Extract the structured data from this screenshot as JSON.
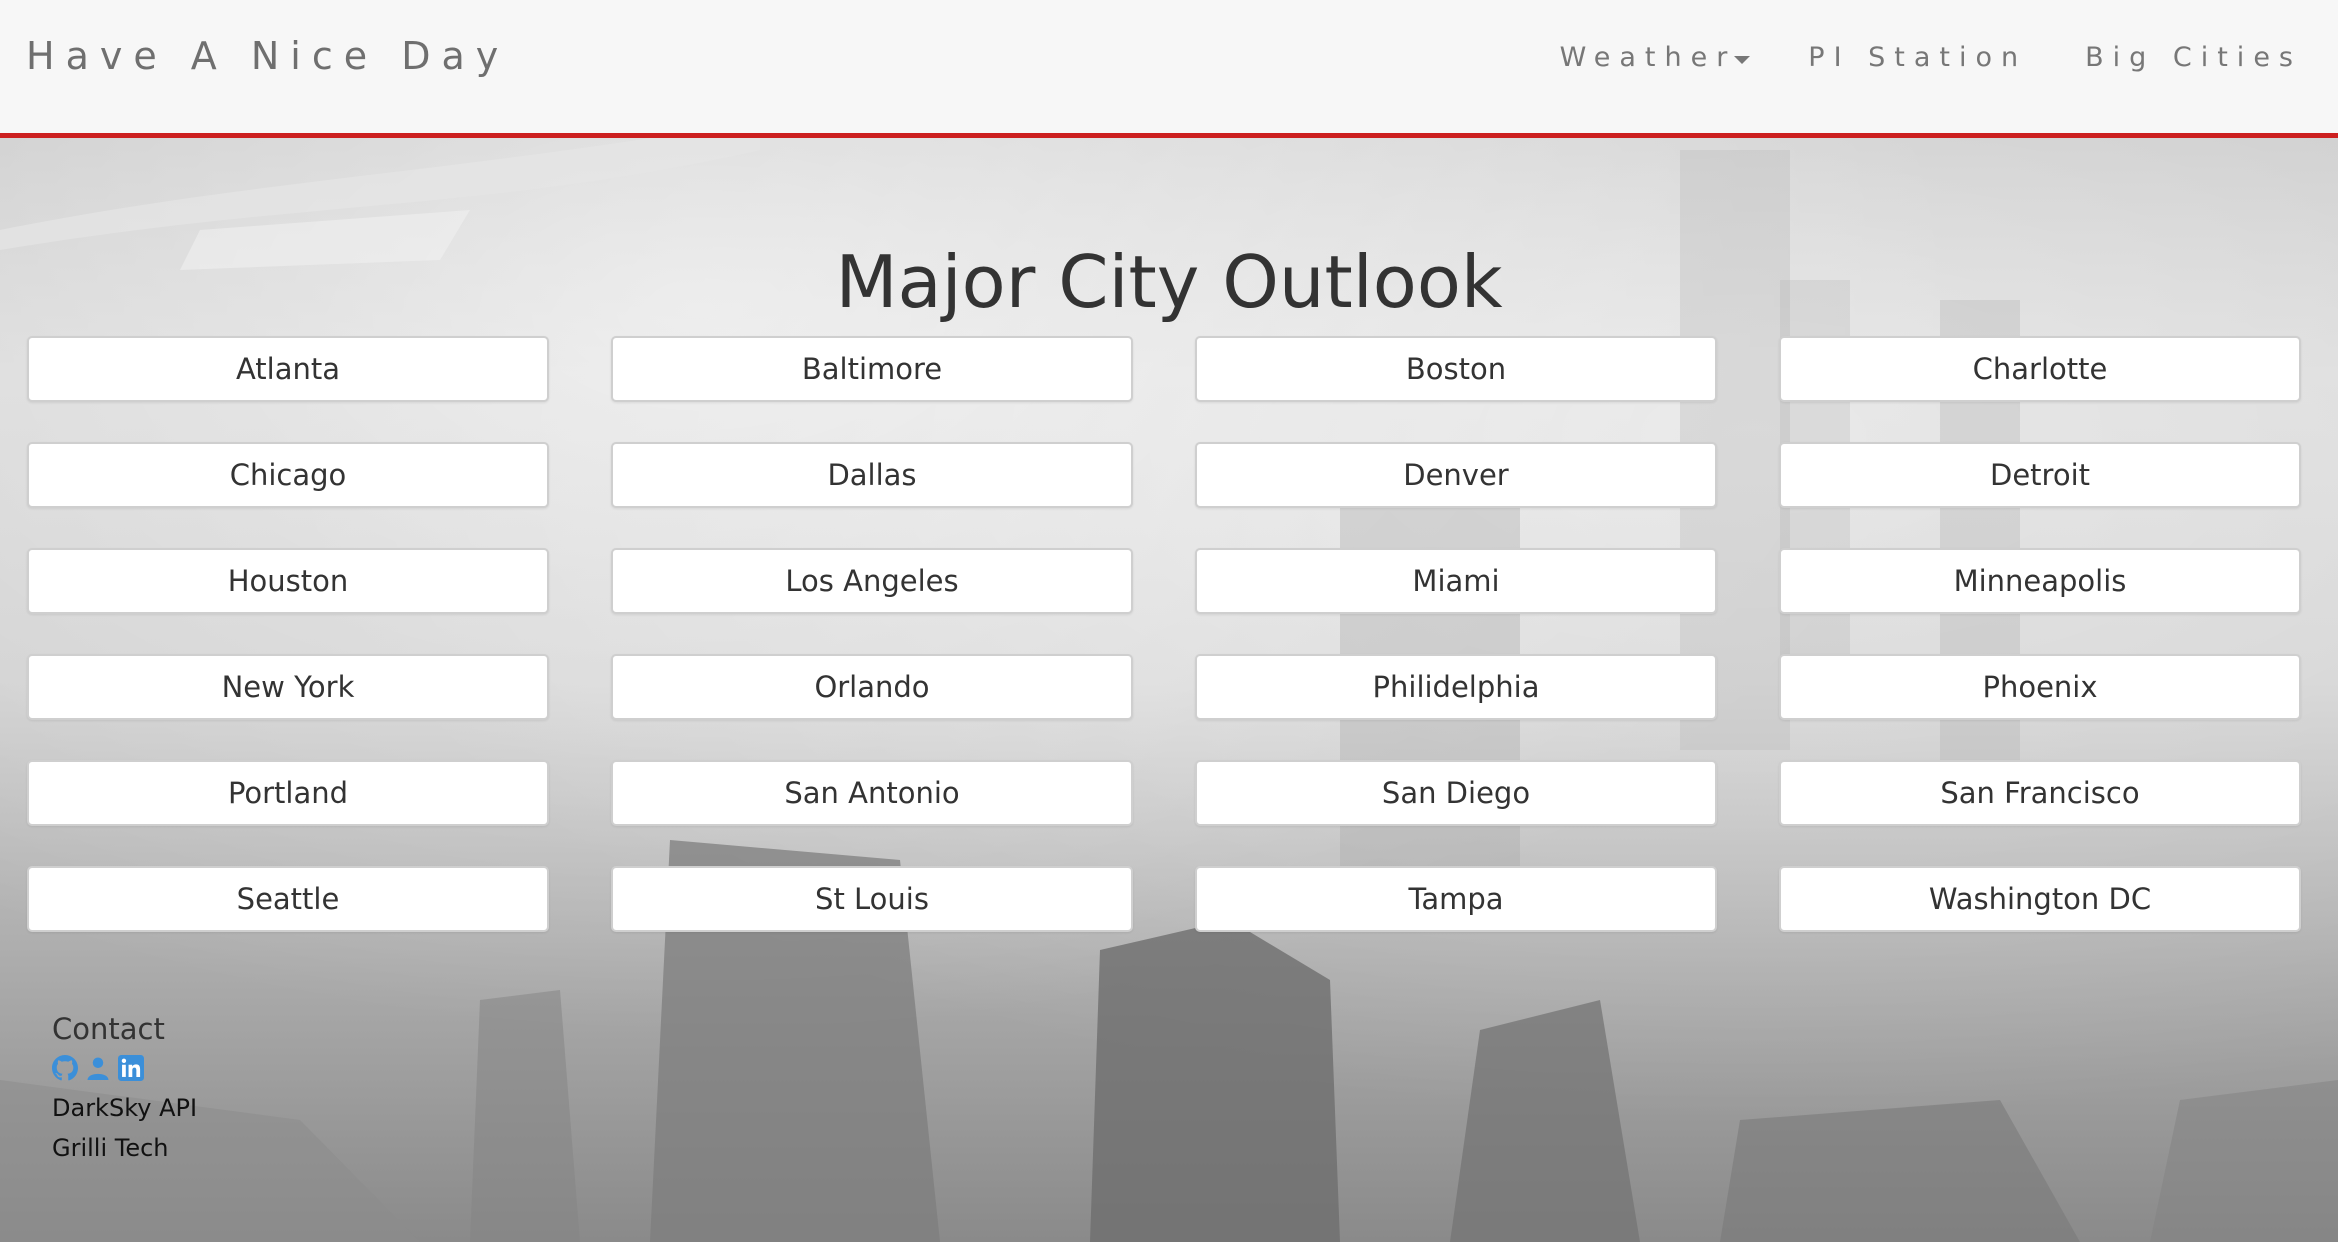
{
  "navbar": {
    "brand": "Have A Nice Day",
    "items": [
      {
        "label": "Weather",
        "has_dropdown": true
      },
      {
        "label": "PI Station",
        "has_dropdown": false
      },
      {
        "label": "Big Cities",
        "has_dropdown": false
      }
    ],
    "accent_color": "#cc1f1f"
  },
  "main": {
    "title": "Major City Outlook",
    "cities": [
      "Atlanta",
      "Baltimore",
      "Boston",
      "Charlotte",
      "Chicago",
      "Dallas",
      "Denver",
      "Detroit",
      "Houston",
      "Los Angeles",
      "Miami",
      "Minneapolis",
      "New York",
      "Orlando",
      "Philidelphia",
      "Phoenix",
      "Portland",
      "San Antonio",
      "San Diego",
      "San Francisco",
      "Seattle",
      "St Louis",
      "Tampa",
      "Washington DC"
    ]
  },
  "footer": {
    "contact_title": "Contact",
    "icons": [
      "github-icon",
      "user-icon",
      "linkedin-icon"
    ],
    "icon_color": "#3b8fd9",
    "links": [
      "DarkSky API",
      "Grilli Tech"
    ]
  }
}
